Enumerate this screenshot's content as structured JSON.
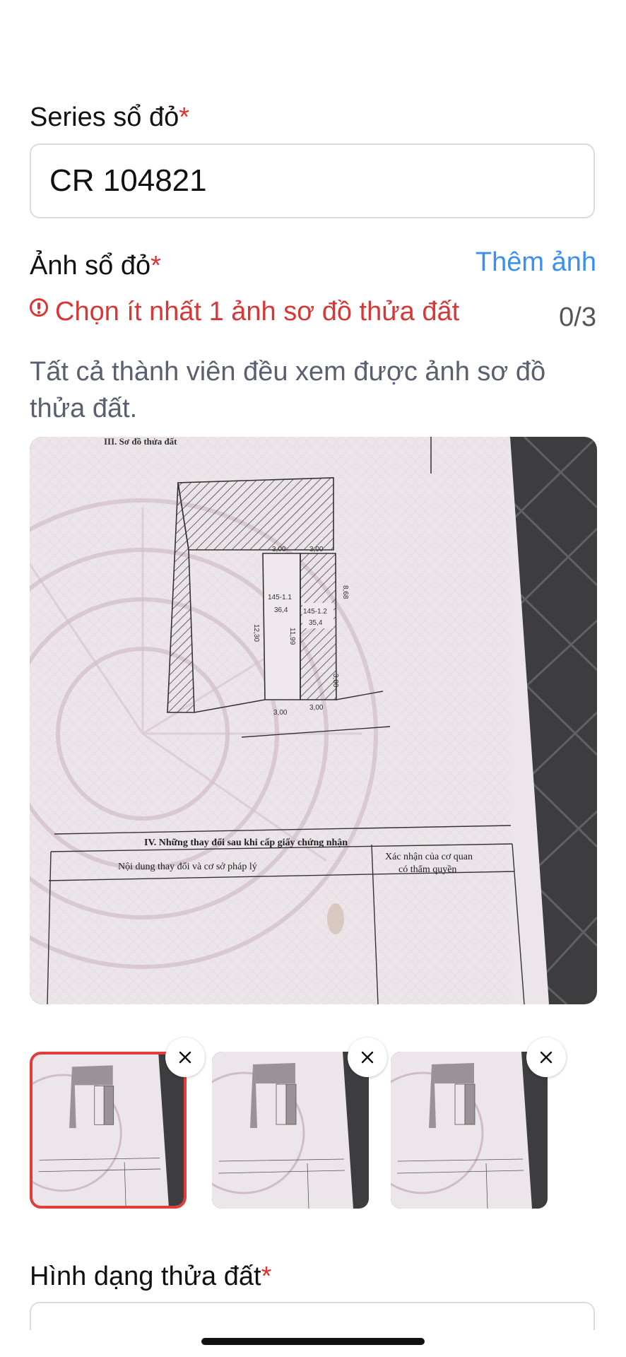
{
  "series": {
    "label": "Series sổ đỏ",
    "required_mark": "*",
    "value": "CR 104821"
  },
  "photos": {
    "label": "Ảnh sổ đỏ",
    "required_mark": "*",
    "add_link": "Thêm ảnh",
    "error": "Chọn ít nhất 1 ảnh sơ đồ thửa đất",
    "count": "0/3",
    "hint": "Tất cả thành viên đều xem được ảnh sơ đồ thửa đất.",
    "main_image": {
      "section_heading": "III. Sơ đồ thửa đất",
      "lot_a": "145-1.1",
      "area_a": "36,4",
      "lot_b": "145-1.2",
      "area_b": "35,4",
      "dim_top_a": "3,00",
      "dim_top_b": "3,00",
      "dim_bottom_a": "3,00",
      "dim_bottom_b": "3,00",
      "dim_left": "12,30",
      "dim_mid": "11,99",
      "dim_right": "8,68",
      "dim_small": "3,00",
      "table_title": "IV. Những thay đổi sau khi cấp giấy chứng nhận",
      "col1": "Nội dung thay đổi và cơ sở pháp lý",
      "col2_line1": "Xác nhận của cơ quan",
      "col2_line2": "có thẩm quyền"
    },
    "thumbnails": [
      {
        "selected": true
      },
      {
        "selected": false
      },
      {
        "selected": false
      }
    ]
  },
  "shape": {
    "label": "Hình dạng thửa đất",
    "required_mark": "*"
  },
  "colors": {
    "accent": "#3c8ff2",
    "error": "#d93636",
    "selected_border": "#e23d3a"
  }
}
